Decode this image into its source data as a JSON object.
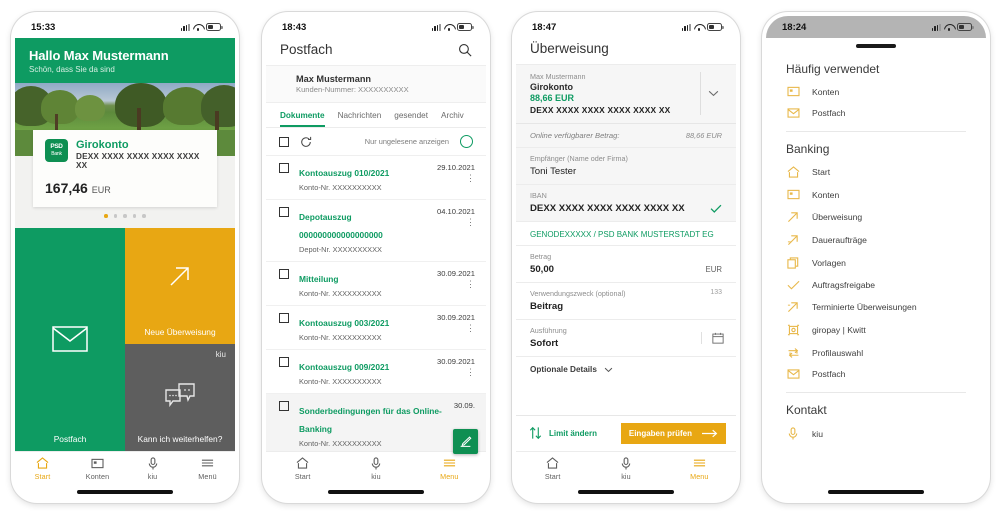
{
  "phones": [
    {
      "id": "home",
      "status": {
        "time": "15:33"
      },
      "hero": {
        "greeting": "Hallo Max Mustermann",
        "subtitle": "Schön, dass Sie da sind"
      },
      "card": {
        "logo_top": "PSD",
        "logo_bottom": "Bank",
        "account_name": "Girokonto",
        "iban": "DEXX XXXX XXXX XXXX XXXX XX",
        "balance": "167,46",
        "currency": "EUR",
        "dots": 5,
        "active_dot": 0
      },
      "tiles": [
        {
          "label": "Postfach",
          "icon": "mail-icon",
          "color": "#0e9b62"
        },
        {
          "label": "Neue Überweisung",
          "icon": "arrow-up-right-icon",
          "color": "#e8a713"
        },
        {
          "label": "Kann ich weiterhelfen?",
          "icon": "chat-bubbles-icon",
          "color": "#5e5e5e",
          "badge": "kiu"
        }
      ],
      "tabs": [
        {
          "label": "Start",
          "icon": "home-icon",
          "active": true
        },
        {
          "label": "Konten",
          "icon": "accounts-icon",
          "active": false
        },
        {
          "label": "kiu",
          "icon": "microphone-icon",
          "active": false
        },
        {
          "label": "Menü",
          "icon": "hamburger-icon",
          "active": false
        }
      ]
    },
    {
      "id": "postfach",
      "status": {
        "time": "18:43"
      },
      "header": {
        "title": "Postfach",
        "search_icon": "search-icon"
      },
      "profile": {
        "name": "Max Mustermann",
        "customer_number": "Kunden-Nummer: XXXXXXXXXX"
      },
      "tabs": [
        {
          "label": "Dokumente",
          "active": true
        },
        {
          "label": "Nachrichten",
          "active": false
        },
        {
          "label": "gesendet",
          "active": false
        },
        {
          "label": "Archiv",
          "active": false
        }
      ],
      "filter": {
        "refresh_icon": "refresh-icon",
        "unread_label": "Nur ungelesene anzeigen",
        "toggle_on": false
      },
      "rows": [
        {
          "title": "Kontoauszug 010/2021",
          "subtitle": "Konto-Nr. XXXXXXXXXX",
          "date": "29.10.2021",
          "selected": false
        },
        {
          "title": "Depotauszug 000000000000000000",
          "subtitle": "Depot-Nr. XXXXXXXXXX",
          "date": "04.10.2021",
          "selected": false
        },
        {
          "title": "Mitteilung",
          "subtitle": "Konto-Nr. XXXXXXXXXX",
          "date": "30.09.2021",
          "selected": false
        },
        {
          "title": "Kontoauszug 003/2021",
          "subtitle": "Konto-Nr. XXXXXXXXXX",
          "date": "30.09.2021",
          "selected": false
        },
        {
          "title": "Kontoauszug 009/2021",
          "subtitle": "Konto-Nr. XXXXXXXXXX",
          "date": "30.09.2021",
          "selected": false
        },
        {
          "title": "Sonderbedingungen für das Online-Banking",
          "subtitle": "Konto-Nr. XXXXXXXXXX",
          "date": "30.09.",
          "selected": true
        }
      ],
      "fab": {
        "icon": "compose-icon"
      },
      "bottom_tabs": [
        {
          "label": "Start",
          "icon": "home-icon",
          "active": false
        },
        {
          "label": "kiu",
          "icon": "microphone-icon",
          "active": false
        },
        {
          "label": "Menu",
          "icon": "hamburger-icon",
          "active": true
        }
      ]
    },
    {
      "id": "ueberweisung",
      "status": {
        "time": "18:47"
      },
      "header": {
        "title": "Überweisung"
      },
      "account": {
        "owner": "Max Mustermann",
        "name": "Girokonto",
        "balance": "88,66 EUR",
        "iban": "DEXX XXXX XXXX XXXX XXXX XX",
        "chevron_icon": "chevron-down-icon"
      },
      "available": {
        "label": "Online verfügbarer Betrag:",
        "value": "88,66 EUR"
      },
      "fields": [
        {
          "label": "Empfänger (Name oder Firma)",
          "value": "Toni Tester",
          "type": "text"
        },
        {
          "label": "IBAN",
          "value": "DEXX XXXX XXXX XXXX XXXX XX",
          "type": "iban",
          "valid_icon": "check-icon"
        }
      ],
      "bank_line": "GENODEXXXXX / PSD BANK MUSTERSTADT EG",
      "amount": {
        "label": "Betrag",
        "value": "50,00",
        "unit": "EUR"
      },
      "purpose": {
        "label": "Verwendungszweck (optional)",
        "value": "Beitrag",
        "counter": "133"
      },
      "execution": {
        "label": "Ausführung",
        "value": "Sofort",
        "calendar_icon": "calendar-icon"
      },
      "optional_details": {
        "label": "Optionale Details",
        "icon": "chevron-down-icon"
      },
      "actions": {
        "limit_label": "Limit ändern",
        "limit_icon": "updown-arrows-icon",
        "submit_label": "Eingaben prüfen",
        "submit_icon": "arrow-right-icon"
      },
      "bottom_tabs": [
        {
          "label": "Start",
          "icon": "home-icon",
          "active": false
        },
        {
          "label": "kiu",
          "icon": "microphone-icon",
          "active": false
        },
        {
          "label": "Menu",
          "icon": "hamburger-icon",
          "active": true
        }
      ]
    },
    {
      "id": "menu",
      "status": {
        "time": "18:24"
      },
      "sections": [
        {
          "title": "Häufig verwendet",
          "items": [
            {
              "label": "Konten",
              "icon": "accounts-icon"
            },
            {
              "label": "Postfach",
              "icon": "mail-icon"
            }
          ]
        },
        {
          "title": "Banking",
          "items": [
            {
              "label": "Start",
              "icon": "home-icon"
            },
            {
              "label": "Konten",
              "icon": "accounts-icon"
            },
            {
              "label": "Überweisung",
              "icon": "arrow-up-right-icon"
            },
            {
              "label": "Daueraufträge",
              "icon": "arrow-up-right-icon"
            },
            {
              "label": "Vorlagen",
              "icon": "copy-icon"
            },
            {
              "label": "Auftragsfreigabe",
              "icon": "check-icon"
            },
            {
              "label": "Terminierte Überweisungen",
              "icon": "arrow-up-right-icon"
            },
            {
              "label": "giropay | Kwitt",
              "icon": "giropay-icon"
            },
            {
              "label": "Profilauswahl",
              "icon": "switch-icon"
            },
            {
              "label": "Postfach",
              "icon": "mail-icon"
            }
          ]
        },
        {
          "title": "Kontakt",
          "items": [
            {
              "label": "kiu",
              "icon": "microphone-icon"
            }
          ]
        }
      ]
    }
  ],
  "colors": {
    "green": "#0e9b62",
    "orange": "#e8a713",
    "gray_tile": "#5e5e5e",
    "dark_text": "#333333"
  }
}
